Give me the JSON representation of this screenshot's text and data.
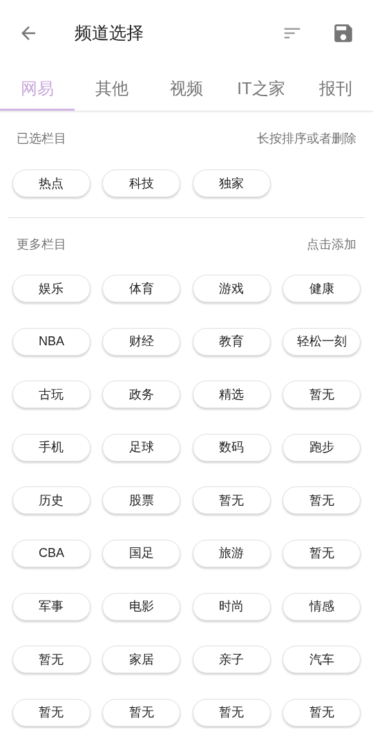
{
  "header": {
    "title": "频道选择"
  },
  "tabs": [
    {
      "label": "网易",
      "selected": true
    },
    {
      "label": "其他",
      "selected": false
    },
    {
      "label": "视频",
      "selected": false
    },
    {
      "label": "IT之家",
      "selected": false
    },
    {
      "label": "报刊",
      "selected": false
    }
  ],
  "selected_section": {
    "title": "已选栏目",
    "hint": "长按排序或者删除",
    "channels": [
      "热点",
      "科技",
      "独家"
    ]
  },
  "more_section": {
    "title": "更多栏目",
    "hint": "点击添加",
    "channels": [
      "娱乐",
      "体育",
      "游戏",
      "健康",
      "NBA",
      "财经",
      "教育",
      "轻松一刻",
      "古玩",
      "政务",
      "精选",
      "暂无",
      "手机",
      "足球",
      "数码",
      "跑步",
      "历史",
      "股票",
      "暂无",
      "暂无",
      "CBA",
      "国足",
      "旅游",
      "暂无",
      "军事",
      "电影",
      "时尚",
      "情感",
      "暂无",
      "家居",
      "亲子",
      "汽车",
      "暂无",
      "暂无",
      "暂无",
      "暂无"
    ]
  }
}
